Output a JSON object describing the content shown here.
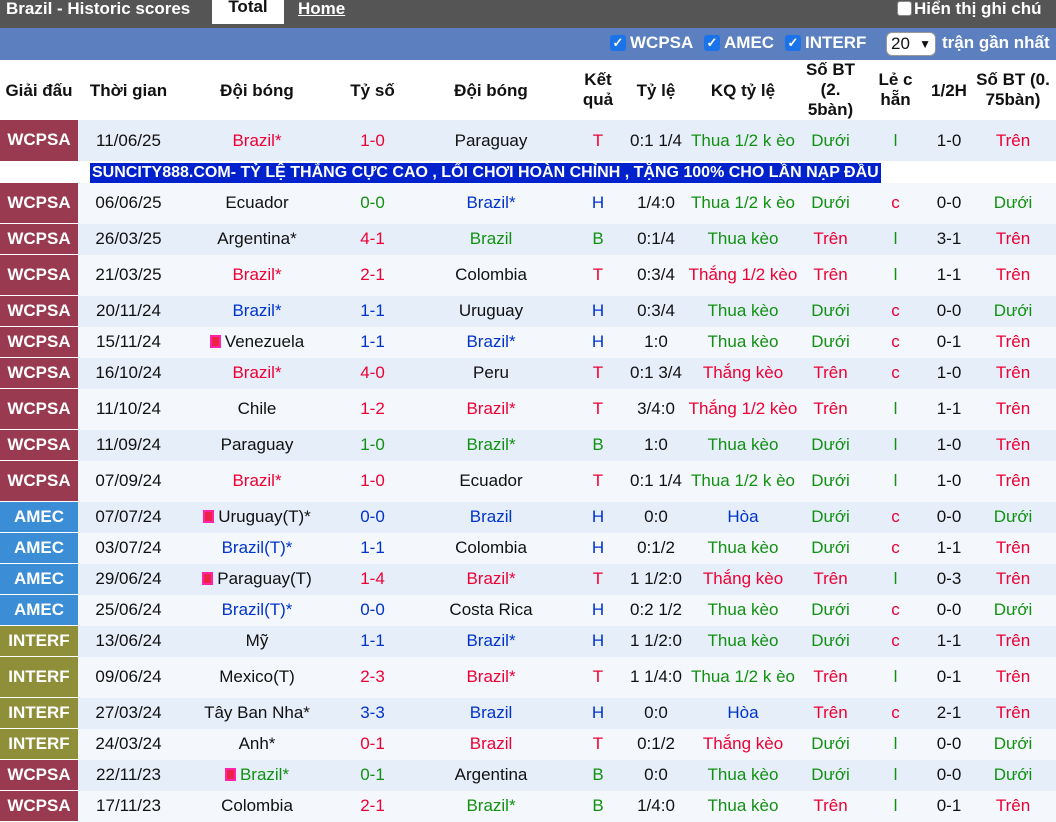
{
  "topbar": {
    "title": "Brazil - Historic scores",
    "tab_total": "Total",
    "tab_home": "Home",
    "hide_label": "Hiển thị ghi chú"
  },
  "filters": {
    "wcpsa": "WCPSA",
    "amec": "AMEC",
    "interf": "INTERF",
    "count": "20",
    "recent": "trận gần nhất"
  },
  "headers": {
    "league": "Giải đấu",
    "time": "Thời gian",
    "team1": "Đội bóng",
    "score": "Tỷ số",
    "team2": "Đội bóng",
    "result": "Kết quả",
    "odds": "Tỷ lệ",
    "odds_result": "KQ tỷ lệ",
    "ou25": "Số BT (2. 5bàn)",
    "oddeven": "Lẻ c hẵn",
    "ht": "1/2H",
    "ou075": "Số BT (0. 75bàn)"
  },
  "colors": {
    "WCPSA": "#993a51",
    "AMEC": "#3b8ed6",
    "INTERF": "#8f8f3a"
  },
  "ad": "SUNCITY888.COM- TỶ LỆ THẮNG CỰC CAO , LỐI CHƠI HOÀN CHỈNH , TẶNG 100% CHO LẦN NẠP ĐẦU",
  "rows": [
    {
      "league": "WCPSA",
      "date": "11/06/25",
      "home": "Brazil*",
      "hc": "red",
      "hflag": false,
      "score": "1-0",
      "sc": "red",
      "away": "Paraguay",
      "ac": "",
      "aflag": false,
      "res": "T",
      "rc": "red",
      "odds": "0:1 1/4",
      "kq": "Thua 1/2 k èo",
      "kc": "green",
      "ou": "Dưới",
      "oc": "green",
      "le": "l",
      "lc": "green",
      "ht": "1-0",
      "ou2": "Trên",
      "o2c": "red",
      "tall": true
    },
    {
      "league": "WCPSA",
      "date": "06/06/25",
      "home": "Ecuador",
      "hc": "",
      "hflag": false,
      "score": "0-0",
      "sc": "green",
      "away": "Brazil*",
      "ac": "blue",
      "aflag": false,
      "res": "H",
      "rc": "blue",
      "odds": "1/4:0",
      "kq": "Thua 1/2 k èo",
      "kc": "green",
      "ou": "Dưới",
      "oc": "green",
      "le": "c",
      "lc": "red",
      "ht": "0-0",
      "ou2": "Dưới",
      "o2c": "green",
      "tall": true
    },
    {
      "league": "WCPSA",
      "date": "26/03/25",
      "home": "Argentina*",
      "hc": "",
      "hflag": false,
      "score": "4-1",
      "sc": "red",
      "away": "Brazil",
      "ac": "green",
      "aflag": false,
      "res": "B",
      "rc": "green",
      "odds": "0:1/4",
      "kq": "Thua kèo",
      "kc": "green",
      "ou": "Trên",
      "oc": "red",
      "le": "l",
      "lc": "green",
      "ht": "3-1",
      "ou2": "Trên",
      "o2c": "red",
      "tall": false
    },
    {
      "league": "WCPSA",
      "date": "21/03/25",
      "home": "Brazil*",
      "hc": "red",
      "hflag": false,
      "score": "2-1",
      "sc": "red",
      "away": "Colombia",
      "ac": "",
      "aflag": false,
      "res": "T",
      "rc": "red",
      "odds": "0:3/4",
      "kq": "Thắng 1/2 kèo",
      "kc": "red",
      "ou": "Trên",
      "oc": "red",
      "le": "l",
      "lc": "green",
      "ht": "1-1",
      "ou2": "Trên",
      "o2c": "red",
      "tall": true
    },
    {
      "league": "WCPSA",
      "date": "20/11/24",
      "home": "Brazil*",
      "hc": "blue",
      "hflag": false,
      "score": "1-1",
      "sc": "blue",
      "away": "Uruguay",
      "ac": "",
      "aflag": false,
      "res": "H",
      "rc": "blue",
      "odds": "0:3/4",
      "kq": "Thua kèo",
      "kc": "green",
      "ou": "Dưới",
      "oc": "green",
      "le": "c",
      "lc": "red",
      "ht": "0-0",
      "ou2": "Dưới",
      "o2c": "green",
      "tall": false
    },
    {
      "league": "WCPSA",
      "date": "15/11/24",
      "home": "Venezuela",
      "hc": "",
      "hflag": true,
      "score": "1-1",
      "sc": "blue",
      "away": "Brazil*",
      "ac": "blue",
      "aflag": false,
      "res": "H",
      "rc": "blue",
      "odds": "1:0",
      "kq": "Thua kèo",
      "kc": "green",
      "ou": "Dưới",
      "oc": "green",
      "le": "c",
      "lc": "red",
      "ht": "0-1",
      "ou2": "Trên",
      "o2c": "red",
      "tall": false
    },
    {
      "league": "WCPSA",
      "date": "16/10/24",
      "home": "Brazil*",
      "hc": "red",
      "hflag": false,
      "score": "4-0",
      "sc": "red",
      "away": "Peru",
      "ac": "",
      "aflag": false,
      "res": "T",
      "rc": "red",
      "odds": "0:1 3/4",
      "kq": "Thắng kèo",
      "kc": "red",
      "ou": "Trên",
      "oc": "red",
      "le": "c",
      "lc": "red",
      "ht": "1-0",
      "ou2": "Trên",
      "o2c": "red",
      "tall": false
    },
    {
      "league": "WCPSA",
      "date": "11/10/24",
      "home": "Chile",
      "hc": "",
      "hflag": false,
      "score": "1-2",
      "sc": "red",
      "away": "Brazil*",
      "ac": "red",
      "aflag": false,
      "res": "T",
      "rc": "red",
      "odds": "3/4:0",
      "kq": "Thắng 1/2 kèo",
      "kc": "red",
      "ou": "Trên",
      "oc": "red",
      "le": "l",
      "lc": "green",
      "ht": "1-1",
      "ou2": "Trên",
      "o2c": "red",
      "tall": true
    },
    {
      "league": "WCPSA",
      "date": "11/09/24",
      "home": "Paraguay",
      "hc": "",
      "hflag": false,
      "score": "1-0",
      "sc": "green",
      "away": "Brazil*",
      "ac": "green",
      "aflag": false,
      "res": "B",
      "rc": "green",
      "odds": "1:0",
      "kq": "Thua kèo",
      "kc": "green",
      "ou": "Dưới",
      "oc": "green",
      "le": "l",
      "lc": "green",
      "ht": "1-0",
      "ou2": "Trên",
      "o2c": "red",
      "tall": false
    },
    {
      "league": "WCPSA",
      "date": "07/09/24",
      "home": "Brazil*",
      "hc": "red",
      "hflag": false,
      "score": "1-0",
      "sc": "red",
      "away": "Ecuador",
      "ac": "",
      "aflag": false,
      "res": "T",
      "rc": "red",
      "odds": "0:1 1/4",
      "kq": "Thua 1/2 k èo",
      "kc": "green",
      "ou": "Dưới",
      "oc": "green",
      "le": "l",
      "lc": "green",
      "ht": "1-0",
      "ou2": "Trên",
      "o2c": "red",
      "tall": true
    },
    {
      "league": "AMEC",
      "date": "07/07/24",
      "home": "Uruguay(T)*",
      "hc": "",
      "hflag": true,
      "score": "0-0",
      "sc": "blue",
      "away": "Brazil",
      "ac": "blue",
      "aflag": false,
      "res": "H",
      "rc": "blue",
      "odds": "0:0",
      "kq": "Hòa",
      "kc": "blue",
      "ou": "Dưới",
      "oc": "green",
      "le": "c",
      "lc": "red",
      "ht": "0-0",
      "ou2": "Dưới",
      "o2c": "green",
      "tall": false
    },
    {
      "league": "AMEC",
      "date": "03/07/24",
      "home": "Brazil(T)*",
      "hc": "blue",
      "hflag": false,
      "score": "1-1",
      "sc": "blue",
      "away": "Colombia",
      "ac": "",
      "aflag": false,
      "res": "H",
      "rc": "blue",
      "odds": "0:1/2",
      "kq": "Thua kèo",
      "kc": "green",
      "ou": "Dưới",
      "oc": "green",
      "le": "c",
      "lc": "red",
      "ht": "1-1",
      "ou2": "Trên",
      "o2c": "red",
      "tall": false
    },
    {
      "league": "AMEC",
      "date": "29/06/24",
      "home": "Paraguay(T)",
      "hc": "",
      "hflag": true,
      "score": "1-4",
      "sc": "red",
      "away": "Brazil*",
      "ac": "red",
      "aflag": false,
      "res": "T",
      "rc": "red",
      "odds": "1 1/2:0",
      "kq": "Thắng kèo",
      "kc": "red",
      "ou": "Trên",
      "oc": "red",
      "le": "l",
      "lc": "green",
      "ht": "0-3",
      "ou2": "Trên",
      "o2c": "red",
      "tall": false
    },
    {
      "league": "AMEC",
      "date": "25/06/24",
      "home": "Brazil(T)*",
      "hc": "blue",
      "hflag": false,
      "score": "0-0",
      "sc": "blue",
      "away": "Costa Rica",
      "ac": "",
      "aflag": false,
      "res": "H",
      "rc": "blue",
      "odds": "0:2 1/2",
      "kq": "Thua kèo",
      "kc": "green",
      "ou": "Dưới",
      "oc": "green",
      "le": "c",
      "lc": "red",
      "ht": "0-0",
      "ou2": "Dưới",
      "o2c": "green",
      "tall": false
    },
    {
      "league": "INTERF",
      "date": "13/06/24",
      "home": "Mỹ",
      "hc": "",
      "hflag": false,
      "score": "1-1",
      "sc": "blue",
      "away": "Brazil*",
      "ac": "blue",
      "aflag": false,
      "res": "H",
      "rc": "blue",
      "odds": "1 1/2:0",
      "kq": "Thua kèo",
      "kc": "green",
      "ou": "Dưới",
      "oc": "green",
      "le": "c",
      "lc": "red",
      "ht": "1-1",
      "ou2": "Trên",
      "o2c": "red",
      "tall": false
    },
    {
      "league": "INTERF",
      "date": "09/06/24",
      "home": "Mexico(T)",
      "hc": "",
      "hflag": false,
      "score": "2-3",
      "sc": "red",
      "away": "Brazil*",
      "ac": "red",
      "aflag": false,
      "res": "T",
      "rc": "red",
      "odds": "1 1/4:0",
      "kq": "Thua 1/2 k èo",
      "kc": "green",
      "ou": "Trên",
      "oc": "red",
      "le": "l",
      "lc": "green",
      "ht": "0-1",
      "ou2": "Trên",
      "o2c": "red",
      "tall": true
    },
    {
      "league": "INTERF",
      "date": "27/03/24",
      "home": "Tây Ban Nha*",
      "hc": "",
      "hflag": false,
      "score": "3-3",
      "sc": "blue",
      "away": "Brazil",
      "ac": "blue",
      "aflag": false,
      "res": "H",
      "rc": "blue",
      "odds": "0:0",
      "kq": "Hòa",
      "kc": "blue",
      "ou": "Trên",
      "oc": "red",
      "le": "c",
      "lc": "red",
      "ht": "2-1",
      "ou2": "Trên",
      "o2c": "red",
      "tall": false
    },
    {
      "league": "INTERF",
      "date": "24/03/24",
      "home": "Anh*",
      "hc": "",
      "hflag": false,
      "score": "0-1",
      "sc": "red",
      "away": "Brazil",
      "ac": "red",
      "aflag": false,
      "res": "T",
      "rc": "red",
      "odds": "0:1/2",
      "kq": "Thắng kèo",
      "kc": "red",
      "ou": "Dưới",
      "oc": "green",
      "le": "l",
      "lc": "green",
      "ht": "0-0",
      "ou2": "Dưới",
      "o2c": "green",
      "tall": false
    },
    {
      "league": "WCPSA",
      "date": "22/11/23",
      "home": "Brazil*",
      "hc": "green",
      "hflag": true,
      "score": "0-1",
      "sc": "green",
      "away": "Argentina",
      "ac": "",
      "aflag": false,
      "res": "B",
      "rc": "green",
      "odds": "0:0",
      "kq": "Thua kèo",
      "kc": "green",
      "ou": "Dưới",
      "oc": "green",
      "le": "l",
      "lc": "green",
      "ht": "0-0",
      "ou2": "Dưới",
      "o2c": "green",
      "tall": false
    },
    {
      "league": "WCPSA",
      "date": "17/11/23",
      "home": "Colombia",
      "hc": "",
      "hflag": false,
      "score": "2-1",
      "sc": "red",
      "away": "Brazil*",
      "ac": "green",
      "aflag": false,
      "res": "B",
      "rc": "green",
      "odds": "1/4:0",
      "kq": "Thua kèo",
      "kc": "green",
      "ou": "Trên",
      "oc": "red",
      "le": "l",
      "lc": "green",
      "ht": "0-1",
      "ou2": "Trên",
      "o2c": "red",
      "tall": false
    }
  ]
}
